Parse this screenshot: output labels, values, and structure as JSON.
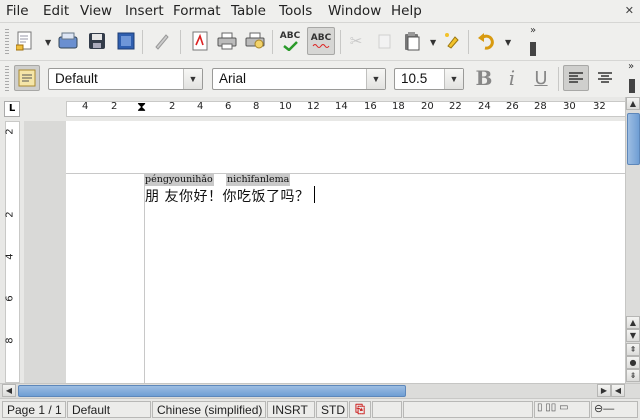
{
  "menus": [
    "File",
    "Edit",
    "View",
    "Insert",
    "Format",
    "Table",
    "Tools",
    "Window",
    "Help"
  ],
  "toolbar1": {
    "icons": [
      "new-document-icon",
      "pdf-export-icon",
      "print-icon",
      "save-icon",
      "edit-file-icon",
      "export-pdf-icon",
      "print-direct-icon",
      "print-preview-icon",
      "spellcheck-icon",
      "autospellcheck-icon",
      "cut-icon",
      "copy-icon",
      "paste-icon",
      "clone-format-icon",
      "undo-icon"
    ],
    "spell_label": "ABC",
    "autospell_label": "ABC"
  },
  "toolbar2": {
    "paragraph_style": "Default",
    "font_name": "Arial",
    "font_size": "10.5",
    "bold_label": "B",
    "italic_label": "i",
    "underline_label": "U"
  },
  "ruler": {
    "h_numbers": [
      "4",
      "2",
      "2",
      "4",
      "6",
      "8",
      "10",
      "12",
      "14",
      "16",
      "18",
      "20",
      "22",
      "24",
      "26",
      "28",
      "30",
      "32"
    ],
    "v_numbers": [
      "2",
      "2",
      "4",
      "6",
      "8"
    ],
    "corner_label": "L"
  },
  "document": {
    "ruby_1": "péngyounihǎo",
    "ruby_2": "nichīfanlema",
    "text": "朋 友你好！你吃饭了吗？"
  },
  "status": {
    "page": "Page 1 / 1",
    "style": "Default",
    "language": "Chinese (simplified)",
    "insert_mode": "INSRT",
    "selection_mode": "STD"
  },
  "colors": {
    "scroll_thumb": "#7fa8d8",
    "accent": "#5d87ba"
  }
}
